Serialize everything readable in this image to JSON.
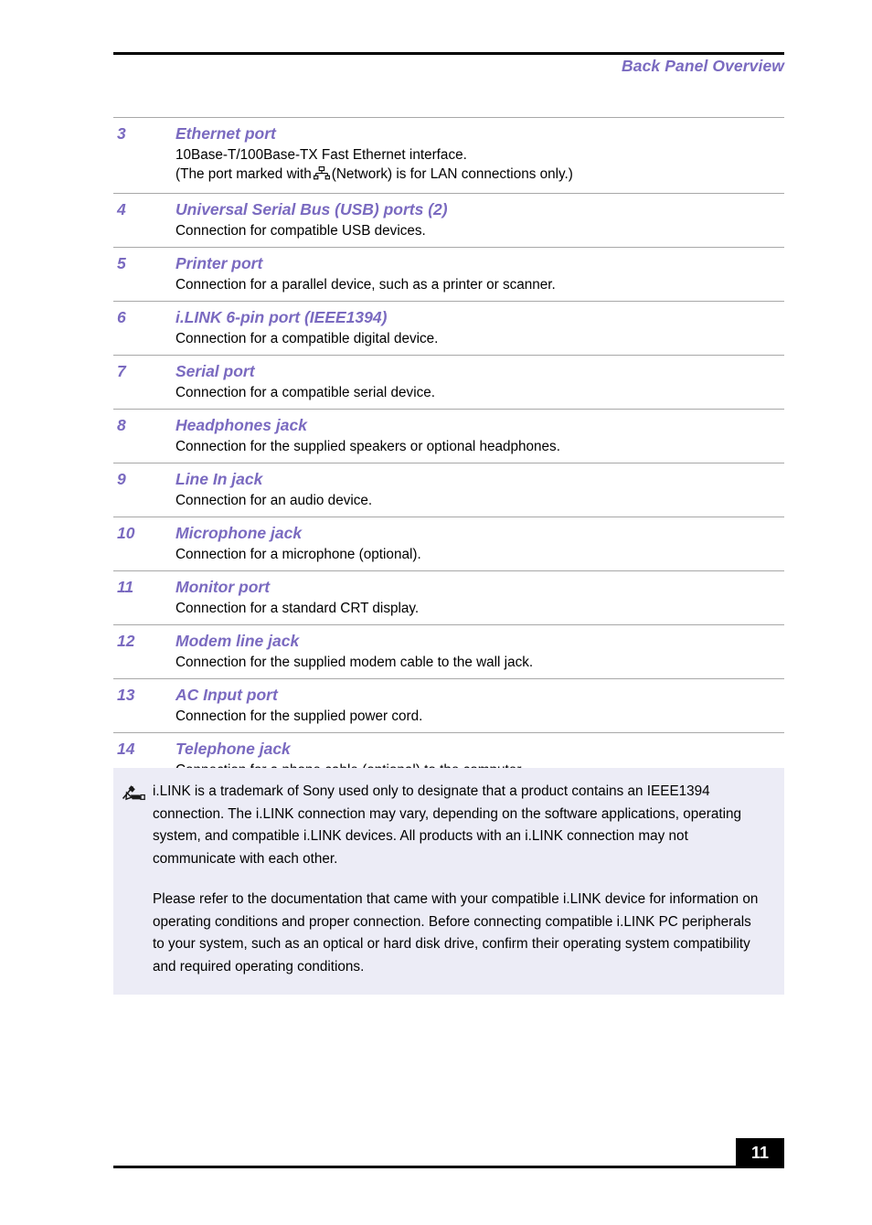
{
  "header": {
    "title": "Back Panel Overview"
  },
  "ports": [
    {
      "number": "3",
      "title": "Ethernet port",
      "desc_line1": "10Base-T/100Base-TX Fast Ethernet interface.",
      "desc_pre": "(The port marked with",
      "icon": "network-icon",
      "desc_post": "(Network) is for LAN connections only.)"
    },
    {
      "number": "4",
      "title": "Universal Serial Bus (USB) ports (2)",
      "desc_line1": "Connection for compatible USB devices."
    },
    {
      "number": "5",
      "title": "Printer port",
      "desc_line1": "Connection for a parallel device, such as a printer or scanner."
    },
    {
      "number": "6",
      "title": "i.LINK 6-pin port (IEEE1394)",
      "desc_line1": "Connection for a compatible digital device."
    },
    {
      "number": "7",
      "title": "Serial port",
      "desc_line1": "Connection for a compatible serial device."
    },
    {
      "number": "8",
      "title": "Headphones jack",
      "desc_line1": "Connection for the supplied speakers or optional headphones."
    },
    {
      "number": "9",
      "title": "Line In jack",
      "desc_line1": "Connection for an audio device."
    },
    {
      "number": "10",
      "title": "Microphone jack",
      "desc_line1": "Connection for a microphone (optional)."
    },
    {
      "number": "11",
      "title": "Monitor port",
      "desc_line1": "Connection for a standard CRT display."
    },
    {
      "number": "12",
      "title": "Modem line jack",
      "desc_line1": "Connection for the supplied modem cable to the wall jack."
    },
    {
      "number": "13",
      "title": "AC Input port",
      "desc_line1": "Connection for the supplied power cord."
    },
    {
      "number": "14",
      "title": "Telephone jack",
      "desc_line1": "Connection for a phone cable (optional) to the computer."
    }
  ],
  "note": {
    "icon": "note-pencil-icon",
    "paragraph1": "i.LINK is a trademark of Sony used only to designate that a product contains an IEEE1394 connection. The i.LINK connection may vary, depending on the software applications, operating system, and compatible i.LINK devices. All products with an i.LINK connection may not communicate with each other.",
    "paragraph2": "Please refer to the documentation that came with your compatible i.LINK device for information on operating conditions and proper connection. Before connecting compatible i.LINK PC peripherals to your system, such as an optical or hard disk drive, confirm their operating system compatibility and required operating conditions."
  },
  "footer": {
    "page_number": "11"
  },
  "colors": {
    "accent_purple": "#7a6ac0",
    "note_background": "#ececf6",
    "rule_black": "#000000",
    "row_divider": "#a8a8a8"
  }
}
